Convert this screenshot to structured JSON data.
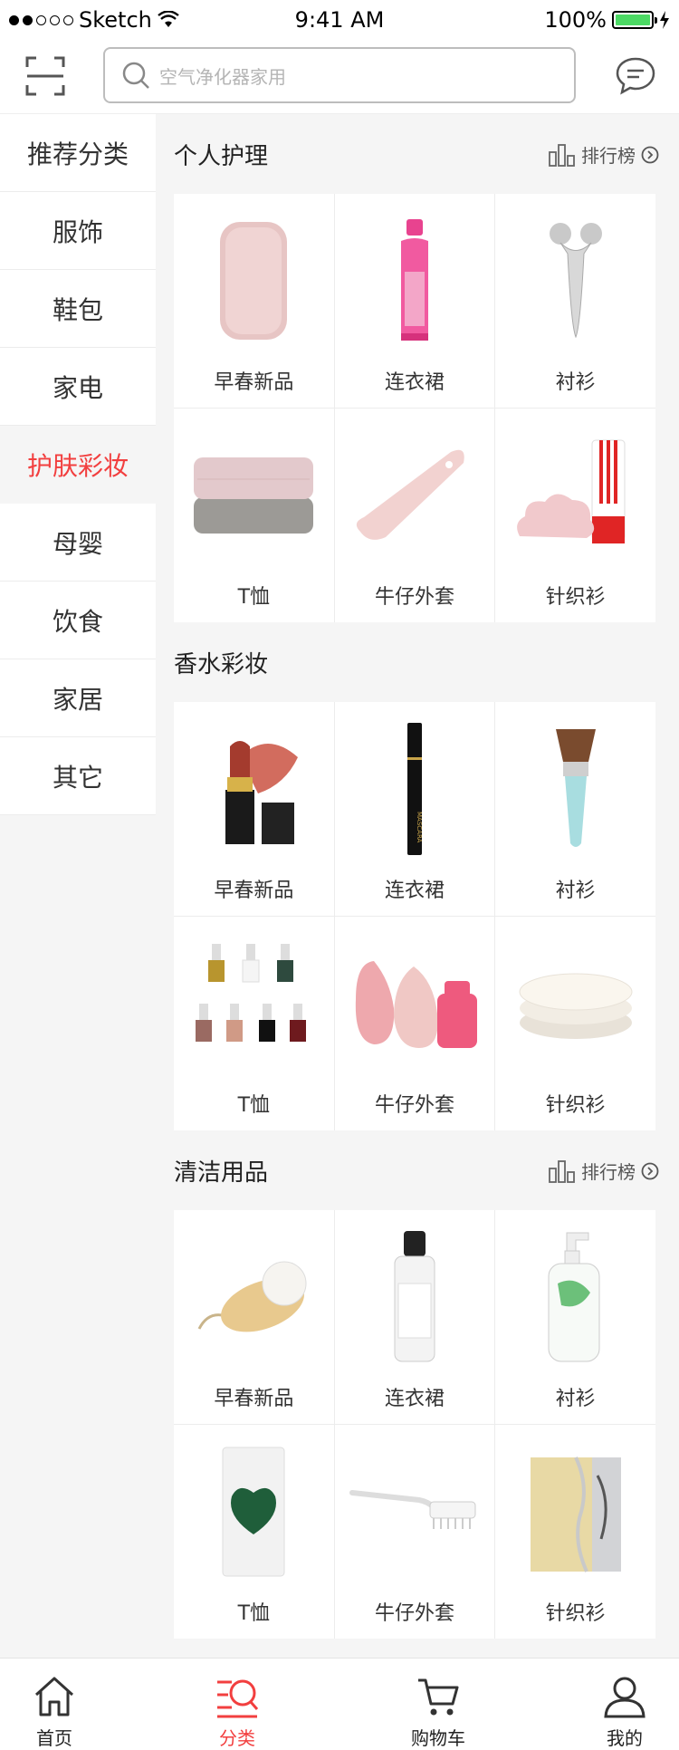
{
  "status_bar": {
    "carrier": "Sketch",
    "time": "9:41 AM",
    "battery": "100%"
  },
  "header": {
    "search_placeholder": "空气净化器家用"
  },
  "sidebar": {
    "items": [
      {
        "label": "推荐分类"
      },
      {
        "label": "服饰"
      },
      {
        "label": "鞋包"
      },
      {
        "label": "家电"
      },
      {
        "label": "护肤彩妆",
        "active": true
      },
      {
        "label": "母婴"
      },
      {
        "label": "饮食"
      },
      {
        "label": "家居"
      },
      {
        "label": "其它"
      }
    ]
  },
  "sections": [
    {
      "title": "个人护理",
      "rank_label": "排行榜",
      "items": [
        {
          "label": "早春新品",
          "icon": "pink-pad-image"
        },
        {
          "label": "连衣裙",
          "icon": "pink-bottle-image"
        },
        {
          "label": "衬衫",
          "icon": "face-roller-image"
        },
        {
          "label": "T恤",
          "icon": "towel-image"
        },
        {
          "label": "牛仔外套",
          "icon": "massager-image"
        },
        {
          "label": "针织衫",
          "icon": "cleanser-image"
        }
      ]
    },
    {
      "title": "香水彩妆",
      "items": [
        {
          "label": "早春新品",
          "icon": "lipstick-image"
        },
        {
          "label": "连衣裙",
          "icon": "mascara-image"
        },
        {
          "label": "衬衫",
          "icon": "makeup-brush-image"
        },
        {
          "label": "T恤",
          "icon": "nail-polish-image"
        },
        {
          "label": "牛仔外套",
          "icon": "beauty-sponge-image"
        },
        {
          "label": "针织衫",
          "icon": "powder-puff-image"
        }
      ]
    },
    {
      "title": "清洁用品",
      "rank_label": "排行榜",
      "items": [
        {
          "label": "早春新品",
          "icon": "face-brush-image"
        },
        {
          "label": "连衣裙",
          "icon": "clear-bottle-image"
        },
        {
          "label": "衬衫",
          "icon": "pump-bottle-image"
        },
        {
          "label": "T恤",
          "icon": "sponge-pack-image"
        },
        {
          "label": "牛仔外套",
          "icon": "cleaning-brush-image"
        },
        {
          "label": "针织衫",
          "icon": "soap-bar-image"
        }
      ]
    }
  ],
  "tabbar": {
    "items": [
      {
        "label": "首页"
      },
      {
        "label": "分类",
        "active": true
      },
      {
        "label": "购物车"
      },
      {
        "label": "我的"
      }
    ]
  },
  "colors": {
    "accent": "#f23f3f",
    "text": "#333333",
    "background": "#f5f5f5"
  }
}
